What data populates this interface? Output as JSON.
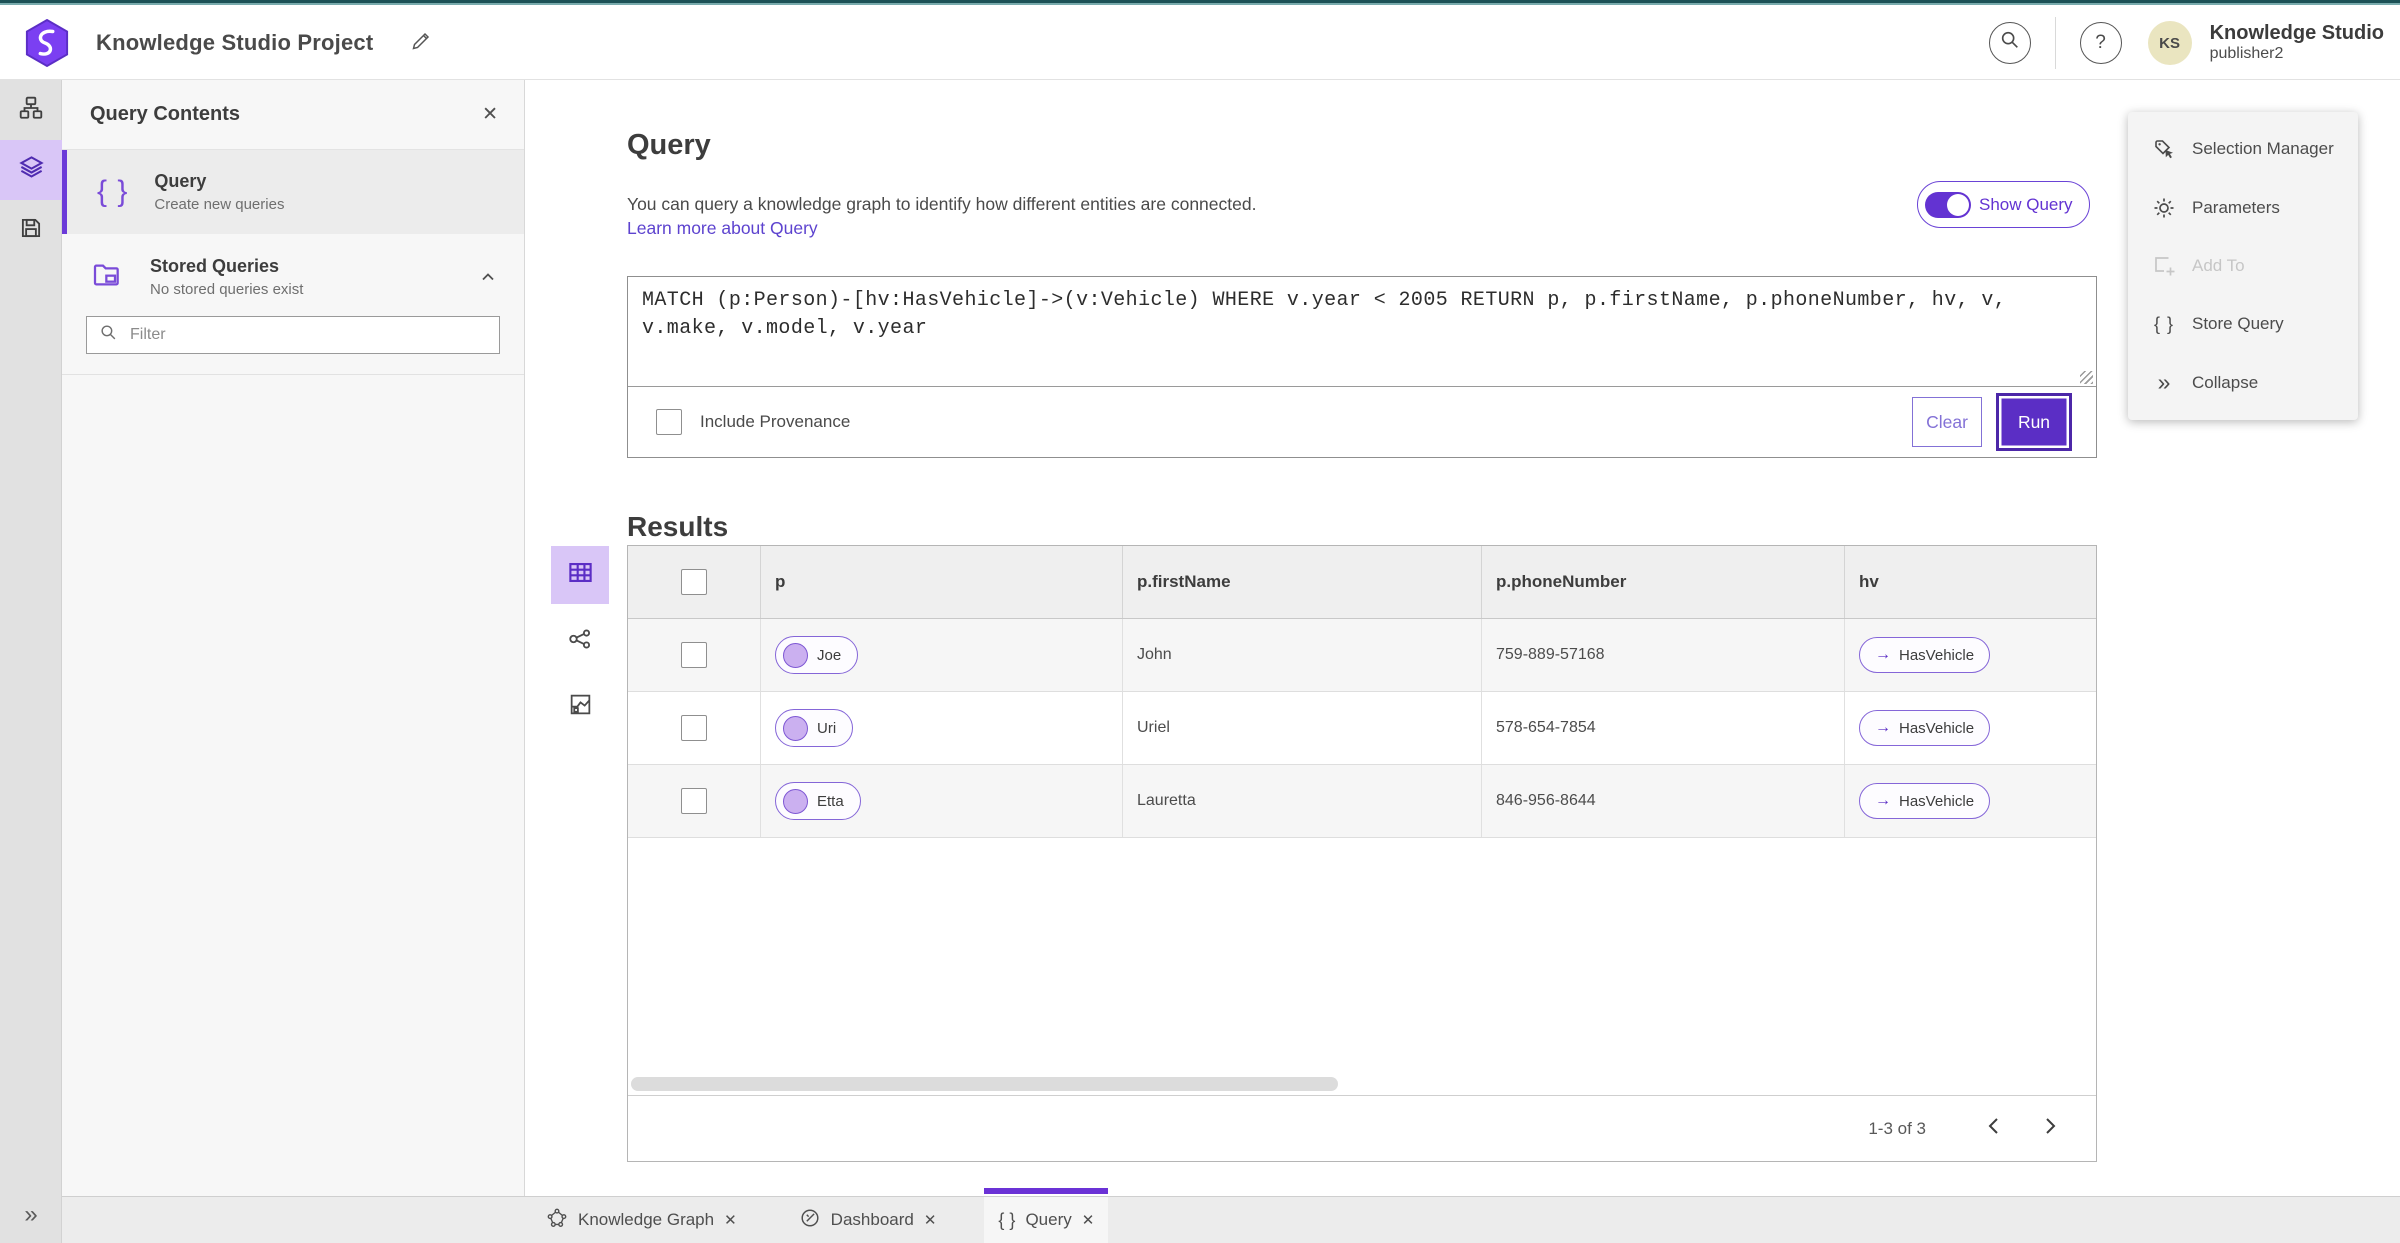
{
  "colors": {
    "accent": "#5B2EC5",
    "accent_light": "#D9C6F7",
    "link": "#5D43CF",
    "top_strip": "#1D5156",
    "avatar_bg": "#EAE5C0"
  },
  "icons": {
    "help": "?",
    "braces": "{ }",
    "close": "✕",
    "double_chevron": "»",
    "arrow_right": "→"
  },
  "header": {
    "title": "Knowledge Studio Project",
    "user": {
      "initials": "KS",
      "name": "Knowledge Studio",
      "role": "publisher2"
    }
  },
  "contents_panel": {
    "title": "Query Contents",
    "query_item": {
      "title": "Query",
      "subtitle": "Create new queries"
    },
    "stored": {
      "title": "Stored Queries",
      "subtitle": "No stored queries exist"
    },
    "filter_placeholder": "Filter"
  },
  "query_section": {
    "heading": "Query",
    "description": "You can query a knowledge graph to identify how different entities are connected.",
    "link_label": "Learn more about Query",
    "show_query_label": "Show Query",
    "query_text": "MATCH (p:Person)-[hv:HasVehicle]->(v:Vehicle) WHERE v.year < 2005 RETURN p, p.firstName, p.phoneNumber, hv, v, v.make, v.model, v.year",
    "include_provenance_label": "Include Provenance",
    "clear_label": "Clear",
    "run_label": "Run"
  },
  "results": {
    "heading": "Results",
    "columns": [
      "p",
      "p.firstName",
      "p.phoneNumber",
      "hv"
    ],
    "rows": [
      {
        "p": "Joe",
        "firstName": "John",
        "phone": "759-889-57168",
        "hv": "HasVehicle"
      },
      {
        "p": "Uri",
        "firstName": "Uriel",
        "phone": "578-654-7854",
        "hv": "HasVehicle"
      },
      {
        "p": "Etta",
        "firstName": "Lauretta",
        "phone": "846-956-8644",
        "hv": "HasVehicle"
      }
    ],
    "pagination": {
      "range": "1-3 of 3"
    }
  },
  "tools_panel": {
    "items": [
      {
        "label": "Selection Manager",
        "disabled": false
      },
      {
        "label": "Parameters",
        "disabled": false
      },
      {
        "label": "Add To",
        "disabled": true
      },
      {
        "label": "Store Query",
        "disabled": false
      },
      {
        "label": "Collapse",
        "disabled": false
      }
    ]
  },
  "tabs": [
    {
      "label": "Knowledge Graph",
      "active": false
    },
    {
      "label": "Dashboard",
      "active": false
    },
    {
      "label": "Query",
      "active": true
    }
  ]
}
